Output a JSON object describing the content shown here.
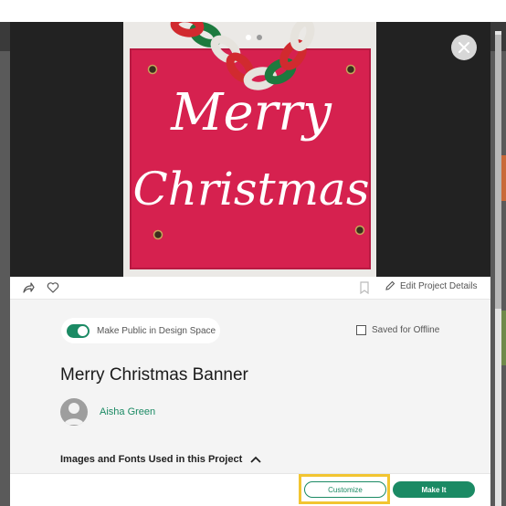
{
  "modal": {
    "title": "Merry Christmas Banner",
    "author": "Aisha Green",
    "edit_details_label": "Edit Project Details",
    "toggle_label": "Make Public in Design Space",
    "offline_label": "Saved for Offline",
    "images_fonts_label": "Images and Fonts Used in this Project",
    "customize_label": "Customize",
    "makeit_label": "Make It",
    "toggle_on": true,
    "offline_checked": false,
    "carousel_count": 2,
    "carousel_active": 1
  },
  "banner_text": {
    "line1": "Merry",
    "line2": "Christmas"
  },
  "colors": {
    "accent": "#1b8a64",
    "highlight": "#f2c531",
    "banner": "#d6214f"
  }
}
